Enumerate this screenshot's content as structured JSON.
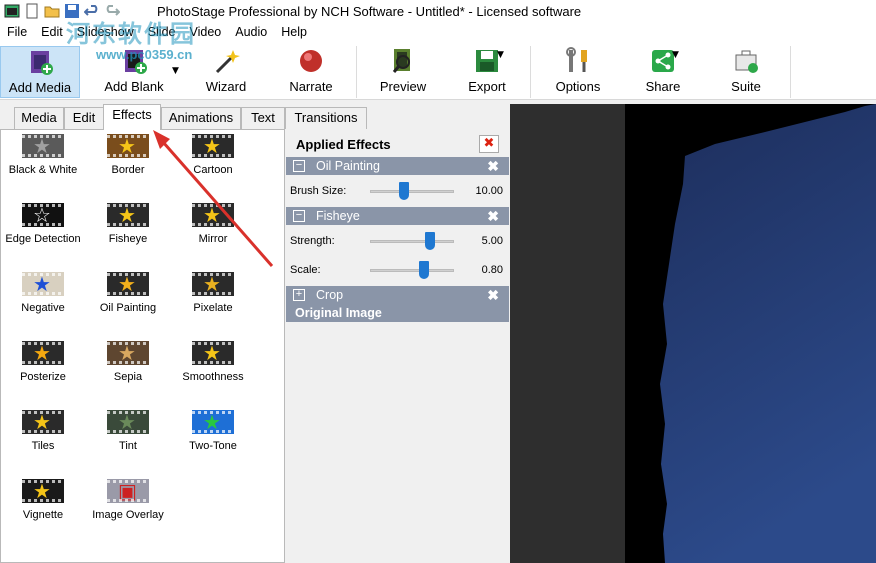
{
  "window": {
    "title": "PhotoStage Professional by NCH Software - Untitled* - Licensed software"
  },
  "watermark": {
    "text": "河东软件园",
    "url": "www.pc0359.cn"
  },
  "menu": [
    "File",
    "Edit",
    "Slideshow",
    "Slide",
    "Video",
    "Audio",
    "Help"
  ],
  "toolbar": {
    "add_media": "Add Media",
    "add_blank": "Add Blank",
    "wizard": "Wizard",
    "narrate": "Narrate",
    "preview": "Preview",
    "export": "Export",
    "options": "Options",
    "share": "Share",
    "suite": "Suite"
  },
  "tabs": [
    "Media",
    "Edit",
    "Effects",
    "Animations",
    "Text",
    "Transitions"
  ],
  "effects": [
    {
      "name": "Black & White",
      "bg": "#5a5a5a",
      "star": "#a0a0a0",
      "glyph": "★"
    },
    {
      "name": "Border",
      "bg": "#7a4d1c",
      "star": "#f5c518",
      "glyph": "★"
    },
    {
      "name": "Cartoon",
      "bg": "#2a2a2a",
      "star": "#f5c518",
      "glyph": "★"
    },
    {
      "name": "Edge Detection",
      "bg": "#111111",
      "star": "#ffffff",
      "glyph": "☆"
    },
    {
      "name": "Fisheye",
      "bg": "#2a2a2a",
      "star": "#f5c518",
      "glyph": "★"
    },
    {
      "name": "Mirror",
      "bg": "#2a2a2a",
      "star": "#f5c518",
      "glyph": "★"
    },
    {
      "name": "Negative",
      "bg": "#d8d0c0",
      "star": "#1d4fd6",
      "glyph": "★"
    },
    {
      "name": "Oil Painting",
      "bg": "#2a2a2a",
      "star": "#f2b01c",
      "glyph": "★"
    },
    {
      "name": "Pixelate",
      "bg": "#2a2a2a",
      "star": "#e8b020",
      "glyph": "★"
    },
    {
      "name": "Posterize",
      "bg": "#2a2a2a",
      "star": "#f5a810",
      "glyph": "★"
    },
    {
      "name": "Sepia",
      "bg": "#5e4630",
      "star": "#d8a860",
      "glyph": "★"
    },
    {
      "name": "Smoothness",
      "bg": "#2a2a2a",
      "star": "#f5c518",
      "glyph": "★"
    },
    {
      "name": "Tiles",
      "bg": "#2a2a2a",
      "star": "#f5c518",
      "glyph": "★"
    },
    {
      "name": "Tint",
      "bg": "#3a4a3a",
      "star": "#6a8a5a",
      "glyph": "★"
    },
    {
      "name": "Two-Tone",
      "bg": "#1e6fd6",
      "star": "#28c840",
      "glyph": "★"
    },
    {
      "name": "Vignette",
      "bg": "#1a1a1a",
      "star": "#f5c518",
      "glyph": "★"
    },
    {
      "name": "Image Overlay",
      "bg": "#9a9aa8",
      "star": "#c22",
      "glyph": "▣"
    }
  ],
  "applied": {
    "header": "Applied Effects",
    "close": "✖",
    "effects": [
      {
        "title": "Oil Painting",
        "toggle": "−",
        "x": "✖",
        "params": [
          {
            "label": "Brush Size:",
            "value": "10.00",
            "fraction": 0.4
          }
        ]
      },
      {
        "title": "Fisheye",
        "toggle": "−",
        "x": "✖",
        "params": [
          {
            "label": "Strength:",
            "value": "5.00",
            "fraction": 0.72
          },
          {
            "label": "Scale:",
            "value": "0.80",
            "fraction": 0.64
          }
        ]
      },
      {
        "title": "Crop",
        "toggle": "+",
        "x": "✖",
        "params": []
      }
    ],
    "original": "Original Image"
  }
}
